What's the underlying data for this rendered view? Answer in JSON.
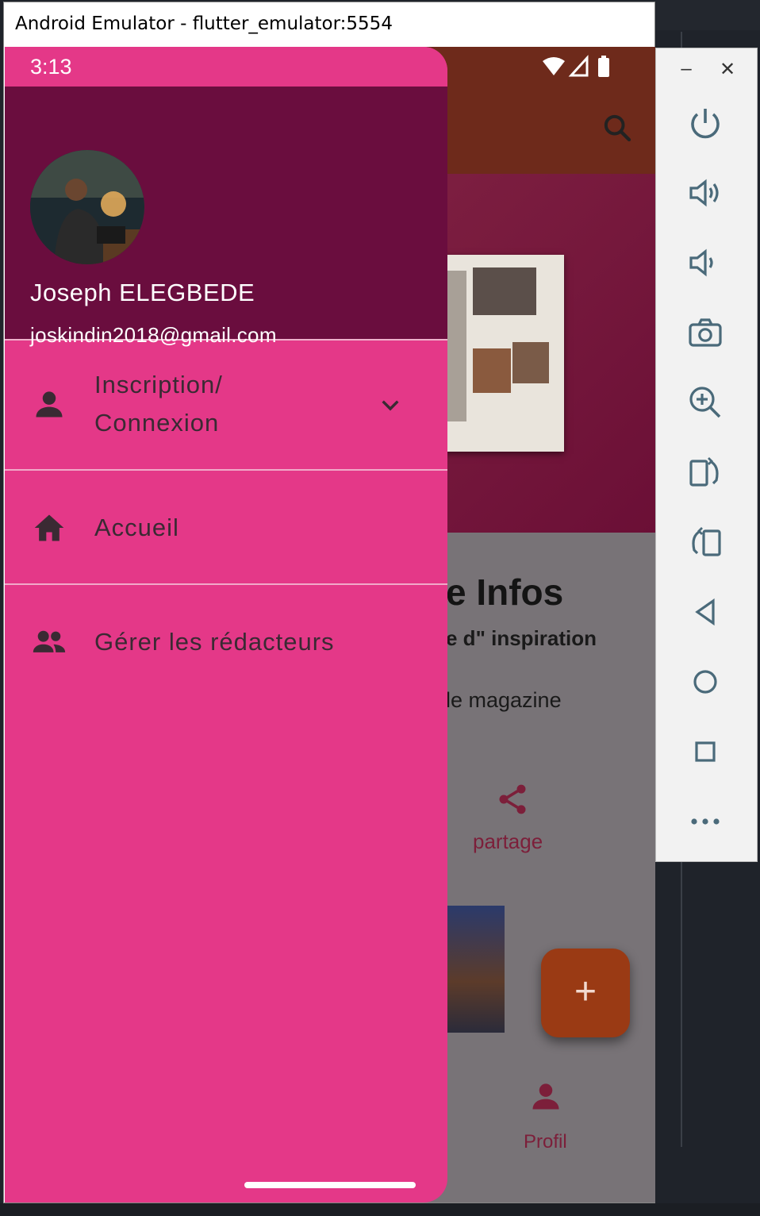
{
  "window": {
    "title": "Android Emulator - flutter_emulator:5554"
  },
  "status_bar": {
    "time": "3:13"
  },
  "drawer": {
    "user_name": "Joseph ELEGBEDE",
    "user_email": "joskindin2018@gmail.com",
    "items": [
      {
        "label_line1": "Inscription/",
        "label_line2": "Connexion",
        "icon": "person-icon",
        "expandable": true
      },
      {
        "label": "Accueil",
        "icon": "home-icon"
      },
      {
        "label": "Gérer les rédacteurs",
        "icon": "group-icon"
      }
    ]
  },
  "background_app": {
    "heading_fragment": "e Infos",
    "subheading_fragment": "e d\" inspiration",
    "magazine_fragment": "le magazine",
    "share_label": "partage",
    "fab_label": "+",
    "profile_label": "Profil"
  },
  "toolbar": {
    "minimize": "–",
    "close": "✕",
    "buttons": [
      "power-icon",
      "volume-up-icon",
      "volume-down-icon",
      "camera-icon",
      "zoom-icon",
      "rotate-right-icon",
      "rotate-left-icon",
      "back-icon",
      "home-circle-icon",
      "overview-icon",
      "more-icon"
    ]
  },
  "colors": {
    "drawer": "#e43888",
    "drawer_header": "#6a0d3e",
    "app_bar": "#6e2a1b",
    "fab": "#9a3a14"
  }
}
